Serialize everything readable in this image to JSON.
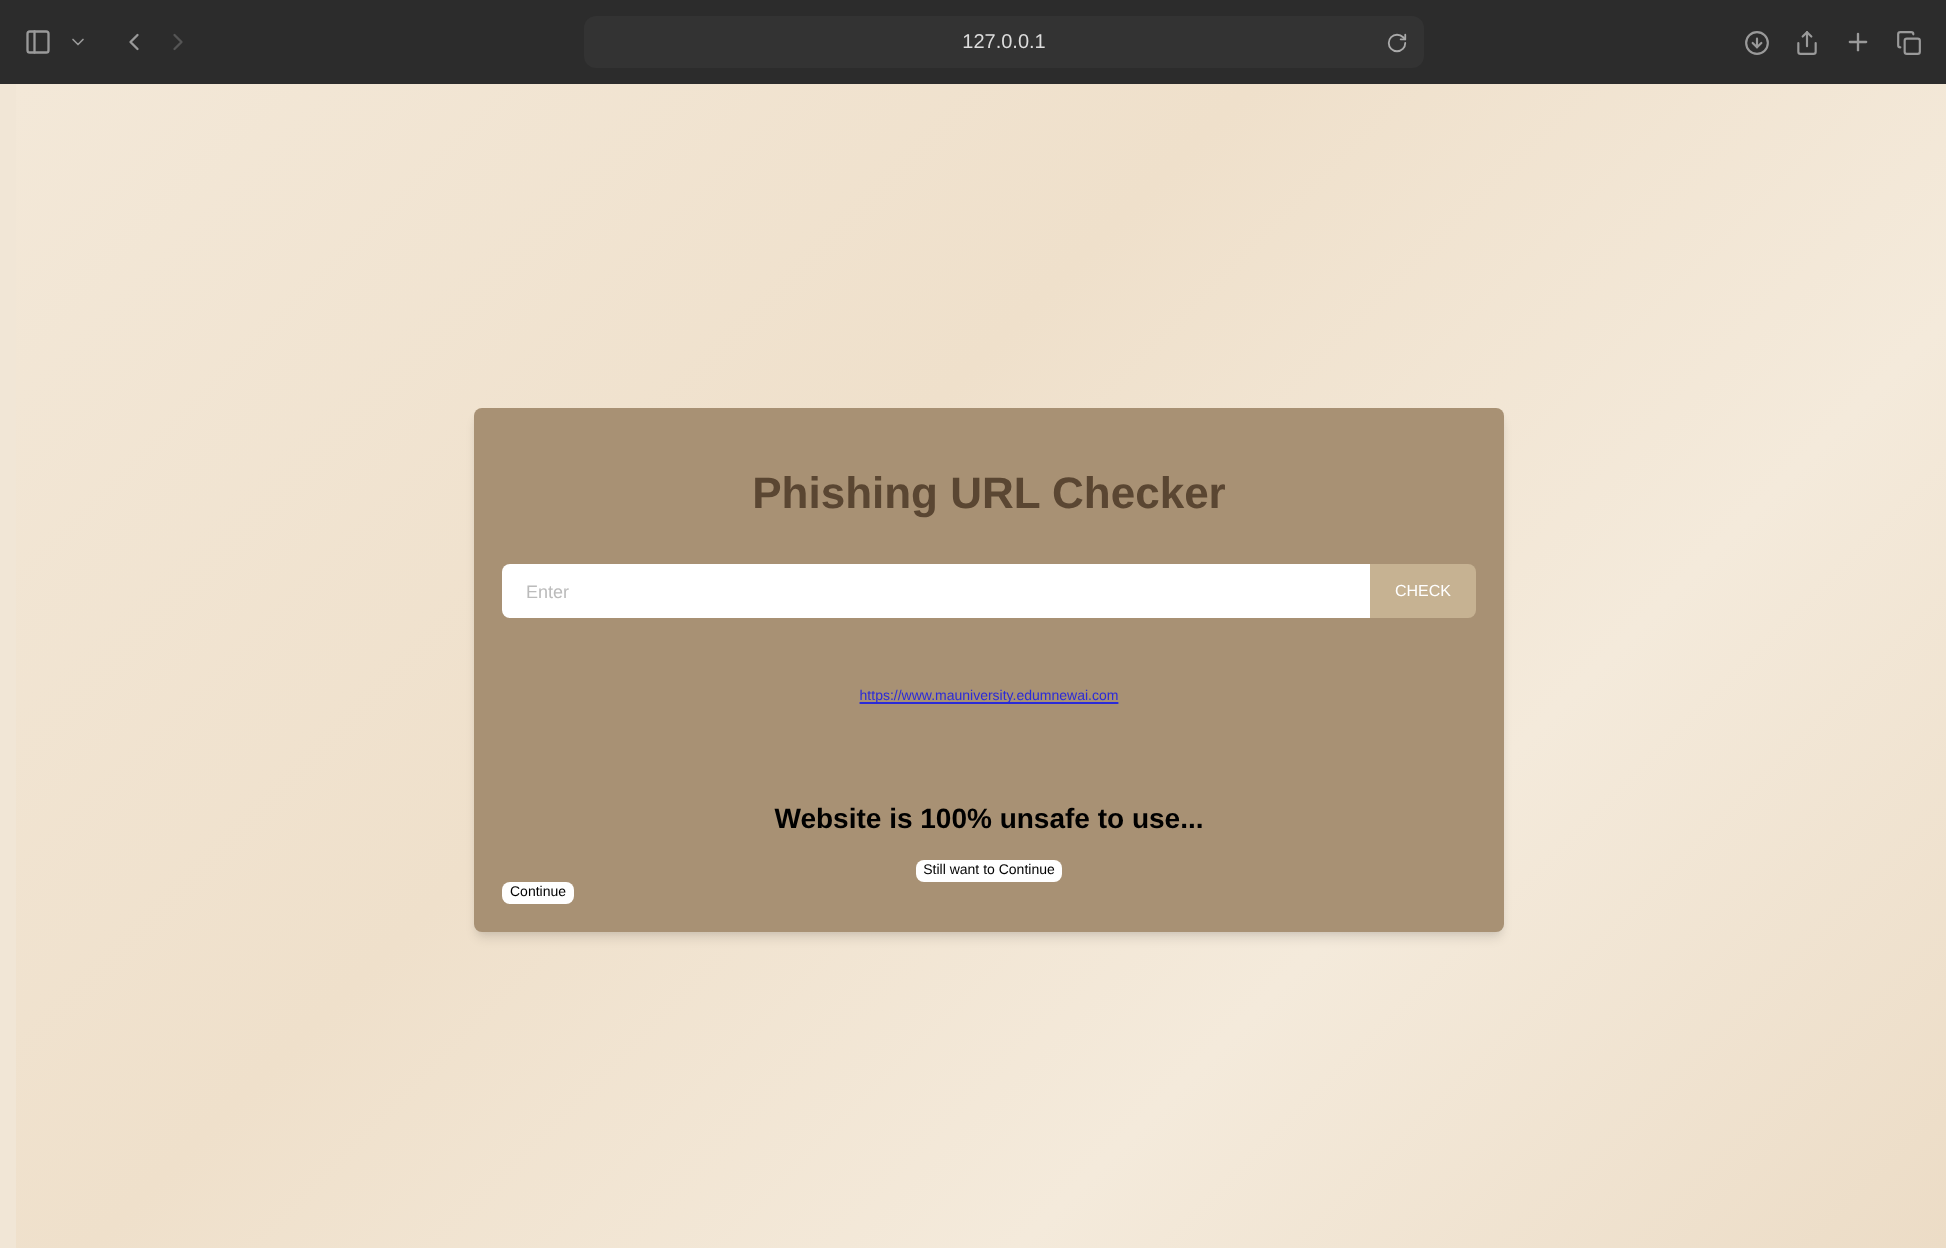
{
  "browser": {
    "address": "127.0.0.1"
  },
  "card": {
    "title": "Phishing URL Checker",
    "input": {
      "placeholder": "Enter"
    },
    "check_button": "CHECK",
    "link": "https://www.mauniversity.edumnewai.com",
    "message": "Website is 100% unsafe to use...",
    "continue_anyway_button": "Still want to Continue",
    "continue_button": "Continue"
  }
}
